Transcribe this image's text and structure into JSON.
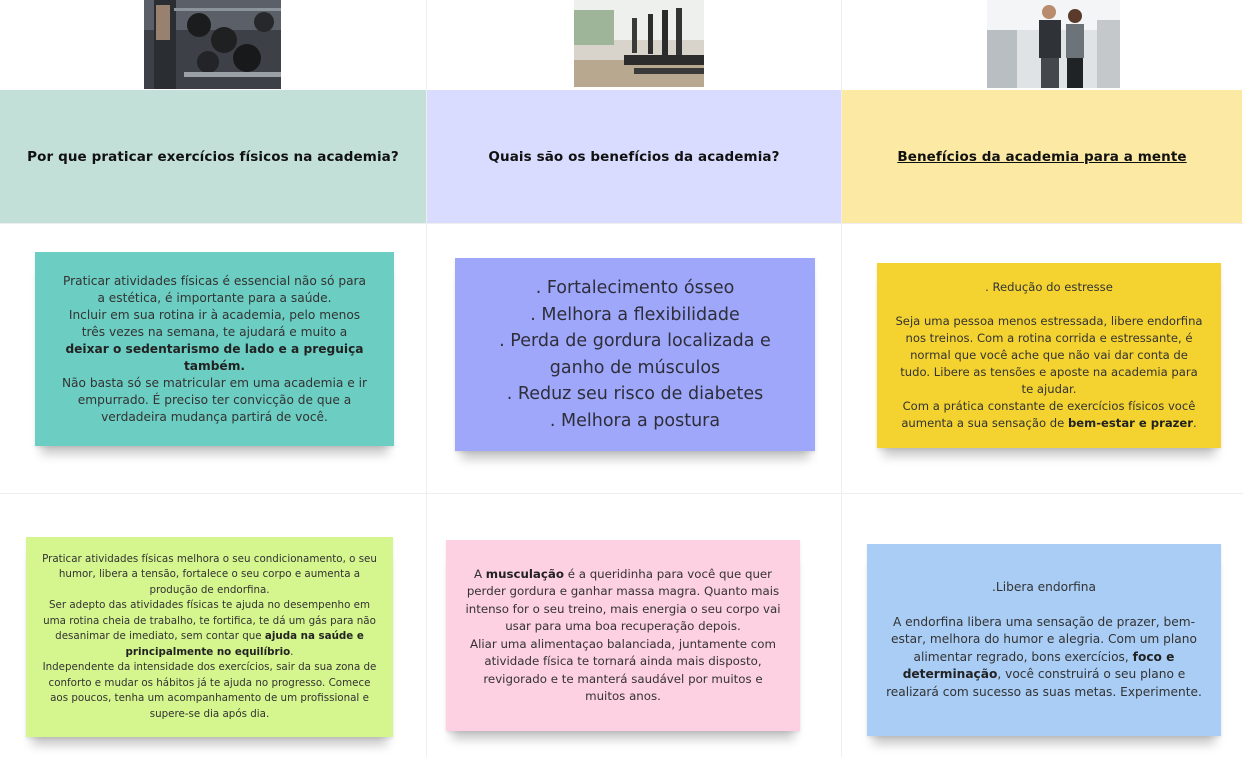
{
  "columns": [
    {
      "photo": "dumbbell-rack-photo",
      "heading": "Por que praticar exercícios físicos na academia?",
      "heading_color": "#c3e0d8"
    },
    {
      "photo": "treadmill-runners-photo",
      "heading": "Quais são os benefícios da academia?",
      "heading_color": "#d9dcfe"
    },
    {
      "photo": "trainer-client-photo",
      "heading": "Benefícios da academia para a mente",
      "heading_color": "#fbe9a4"
    }
  ],
  "notes": {
    "teal": {
      "color": "#6ccdc2",
      "line1": "Praticar atividades físicas é essencial não só para a estética, é importante para a saúde.",
      "line2_prefix": "Incluir em sua rotina ir à academia, pelo menos três vezes na semana, te ajudará e muito a ",
      "line2_bold": "deixar o sedentarismo de lado e a preguiça também.",
      "line3": "Não basta só se matricular em uma academia e ir empurrado. É preciso ter convicção de que a verdadeira mudança partirá de você."
    },
    "lavender": {
      "color": "#9ea7f9",
      "items": [
        ". Fortalecimento ósseo",
        ". Melhora a flexibilidade",
        ". Perda de gordura localizada e ganho de músculos",
        ". Reduz seu risco de diabetes",
        ". Melhora a postura"
      ]
    },
    "yellow": {
      "color": "#f4d330",
      "title": ". Redução do estresse",
      "body1": "Seja uma pessoa menos estressada, libere endorfina nos treinos. Com a rotina corrida e estressante, é normal que você ache que não vai dar conta de tudo. Libere as tensões e aposte na academia para te ajudar.",
      "body2_prefix": "Com a prática constante de exercícios físicos você aumenta a sua sensação de ",
      "body2_bold": "bem-estar e prazer",
      "body2_suffix": "."
    },
    "green": {
      "color": "#d5f58e",
      "p1": "Praticar atividades físicas melhora o seu condicionamento, o seu humor, libera a tensão, fortalece o seu corpo e aumenta a produção de endorfina.",
      "p2_prefix": "Ser adepto das atividades físicas te ajuda no desempenho em uma rotina cheia de trabalho, te fortifica, te dá um gás para não desanimar de imediato, sem contar que ",
      "p2_bold": "ajuda na saúde e principalmente no equilíbrio",
      "p2_suffix": ".",
      "p3": "Independente da intensidade dos exercícios, sair da sua zona de conforto e mudar os hábitos já te ajuda no progresso. Comece aos poucos, tenha um acompanhamento de um profissional e supere-se dia após dia."
    },
    "pink": {
      "color": "#fdd0e2",
      "p1_prefix": "A ",
      "p1_bold": "musculação",
      "p1_suffix": " é a queridinha para você que quer perder gordura e ganhar massa magra. Quanto mais intenso for o seu treino, mais energia o seu corpo vai usar para uma boa recuperação depois.",
      "p2": "Aliar uma alimentaçao balanciada, juntamente com atividade física te tornará ainda mais disposto, revigorado e te manterá saudável por muitos e muitos anos."
    },
    "blue": {
      "color": "#a9cdf5",
      "title": ".Libera endorfina",
      "body_prefix": "A endorfina libera uma sensação de prazer, bem-estar, melhora do humor e alegria. Com um plano alimentar regrado, bons exercícios, ",
      "body_bold": "foco e determinação",
      "body_suffix": ", você construirá o seu plano e realizará com sucesso as suas metas. Experimente."
    }
  }
}
